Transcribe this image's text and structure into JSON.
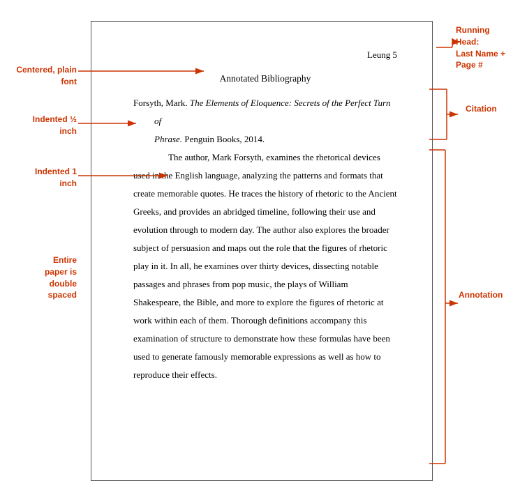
{
  "page": {
    "running_head": "Leung 5",
    "bib_title": "Annotated Bibliography",
    "citation_text": "Forsyth, Mark. The Elements of Eloquence: Secrets of the Perfect Turn of Phrase. Penguin Books, 2014.",
    "citation_italic": "The Elements of Eloquence: Secrets of the Perfect Turn of Phrase.",
    "annotation": "The author, Mark Forsyth, examines the rhetorical devices used in the English language, analyzing the patterns and formats that create memorable quotes. He traces the history of rhetoric to the Ancient Greeks, and provides an abridged timeline, following their use and evolution through to modern day. The author also explores the broader subject of persuasion and maps out the role that the figures of rhetoric play in it. In all, he examines over thirty devices, dissecting notable passages and phrases from pop music, the plays of William Shakespeare, the Bible, and more to explore the figures of rhetoric at work within each of them. Thorough definitions accompany this examination of structure to demonstrate how these formulas have been used to generate famously memorable expressions as well as how to reproduce their effects."
  },
  "labels": {
    "centered": "Centered,\nplain font",
    "half_inch": "Indented ½\ninch",
    "one_inch": "Indented 1\ninch",
    "double_spaced": "Entire\npaper is\ndouble\nspaced",
    "running_head": "Running\nHead:\nLast Name +\nPage #",
    "citation": "Citation",
    "annotation": "Annotation"
  }
}
